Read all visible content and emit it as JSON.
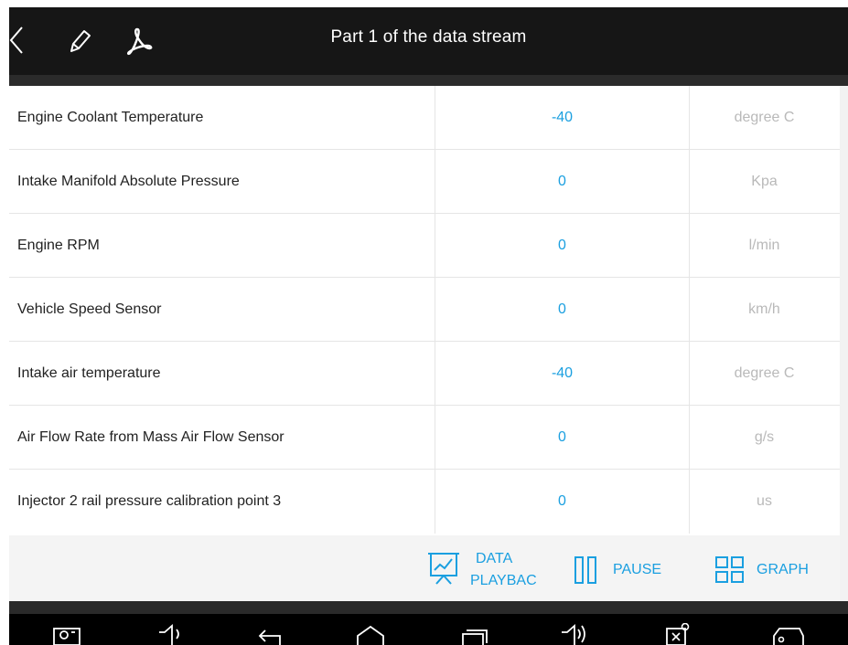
{
  "header": {
    "title": "Part 1 of the data stream"
  },
  "rows": [
    {
      "name": "Engine Coolant Temperature",
      "value": "-40",
      "unit": "degree C"
    },
    {
      "name": "Intake Manifold Absolute Pressure",
      "value": "0",
      "unit": "Kpa"
    },
    {
      "name": "Engine RPM",
      "value": "0",
      "unit": "l/min"
    },
    {
      "name": "Vehicle Speed Sensor",
      "value": "0",
      "unit": "km/h"
    },
    {
      "name": "Intake air temperature",
      "value": "-40",
      "unit": "degree C"
    },
    {
      "name": "Air Flow Rate from Mass Air Flow Sensor",
      "value": "0",
      "unit": "g/s"
    },
    {
      "name": "Injector 2 rail pressure calibration point 3",
      "value": "0",
      "unit": "us"
    }
  ],
  "actions": {
    "playback_line1": "DATA",
    "playback_line2": "PLAYBAC",
    "pause": "PAUSE",
    "graph": "GRAPH"
  },
  "icons": {
    "back": "back-chevron-icon",
    "edit": "pencil-icon",
    "pdf": "pdf-icon",
    "playback": "presentation-chart-icon",
    "pause": "pause-icon",
    "graph": "grid-icon",
    "nav": [
      "screenshot-icon",
      "volume-down-icon",
      "back-arrow-icon",
      "home-icon",
      "recent-apps-icon",
      "volume-up-icon",
      "vci-icon",
      "car-icon"
    ]
  },
  "colors": {
    "accent": "#1a9fe0",
    "unit_text": "#b9b9b9",
    "title_bar": "#161616"
  }
}
